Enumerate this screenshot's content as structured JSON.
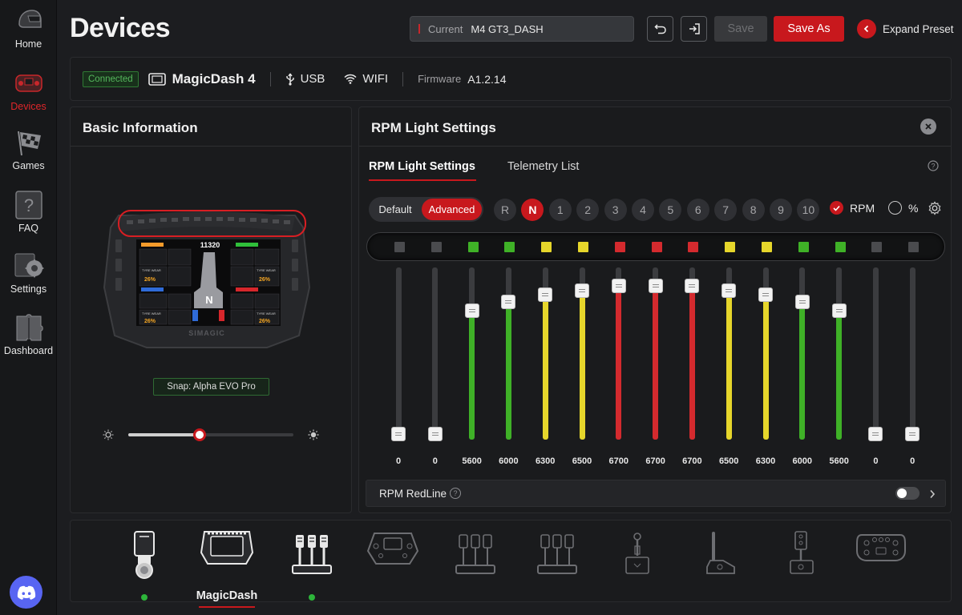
{
  "sidebar": {
    "items": [
      {
        "label": "Home",
        "icon": "helmet-icon",
        "active": false
      },
      {
        "label": "Devices",
        "icon": "wheel-icon",
        "active": true
      },
      {
        "label": "Games",
        "icon": "checkered-flag-icon",
        "active": false
      },
      {
        "label": "FAQ",
        "icon": "question-icon",
        "active": false
      },
      {
        "label": "Settings",
        "icon": "gear-icon",
        "active": false
      },
      {
        "label": "Dashboard",
        "icon": "puzzle-icon",
        "active": false
      }
    ],
    "discord_icon": "discord-icon"
  },
  "header": {
    "title": "Devices",
    "preset_label": "Current",
    "preset_value": "M4 GT3_DASH",
    "save_label": "Save",
    "save_as_label": "Save As",
    "expand_label": "Expand Preset"
  },
  "device_bar": {
    "status": "Connected",
    "device_name": "MagicDash 4",
    "usb_label": "USB",
    "wifi_label": "WIFI",
    "firmware_label": "Firmware",
    "firmware_value": "A1.2.14"
  },
  "basic_info": {
    "title": "Basic Information",
    "snap_label": "Snap: Alpha EVO Pro",
    "brightness": 0.43,
    "dash_screen": {
      "rpm_readout": "11320",
      "gear": "N",
      "tyre_wear_label": "TYRE WEAR",
      "tyre_wear": [
        "26%",
        "26%",
        "26%",
        "26%"
      ]
    }
  },
  "rpm_panel": {
    "title": "RPM Light Settings",
    "tabs": [
      "RPM Light Settings",
      "Telemetry List"
    ],
    "active_tab": 0,
    "mode_default": "Default",
    "mode_advanced": "Advanced",
    "gears": [
      "R",
      "N",
      "1",
      "2",
      "3",
      "4",
      "5",
      "6",
      "7",
      "8",
      "9",
      "10"
    ],
    "selected_gear": "N",
    "unit_rpm": "RPM",
    "unit_percent": "%",
    "rpm_scale_max": 7500,
    "leds": [
      {
        "color": "#4a4b4e",
        "value": 0
      },
      {
        "color": "#4a4b4e",
        "value": 0
      },
      {
        "color": "#3fb127",
        "value": 5600
      },
      {
        "color": "#3fb127",
        "value": 6000
      },
      {
        "color": "#e6d62b",
        "value": 6300
      },
      {
        "color": "#e6d62b",
        "value": 6500
      },
      {
        "color": "#d42a2e",
        "value": 6700
      },
      {
        "color": "#d42a2e",
        "value": 6700
      },
      {
        "color": "#d42a2e",
        "value": 6700
      },
      {
        "color": "#e6d62b",
        "value": 6500
      },
      {
        "color": "#e6d62b",
        "value": 6300
      },
      {
        "color": "#3fb127",
        "value": 6000
      },
      {
        "color": "#3fb127",
        "value": 5600
      },
      {
        "color": "#4a4b4e",
        "value": 0
      },
      {
        "color": "#4a4b4e",
        "value": 0
      }
    ],
    "redline_label": "RPM RedLine",
    "redline_enabled": false
  },
  "device_tray": {
    "items": [
      {
        "icon": "shifter-icon",
        "connected": true
      },
      {
        "icon": "dash-icon",
        "label": "MagicDash",
        "selected": true
      },
      {
        "icon": "pedals-icon",
        "connected": true
      },
      {
        "icon": "steering-wheel-icon"
      },
      {
        "icon": "pedals-outline-icon"
      },
      {
        "icon": "pedals-outline-2-icon"
      },
      {
        "icon": "joystick-icon"
      },
      {
        "icon": "handbrake-icon"
      },
      {
        "icon": "sequential-shifter-icon"
      },
      {
        "icon": "gamepad-wheel-icon"
      }
    ]
  }
}
